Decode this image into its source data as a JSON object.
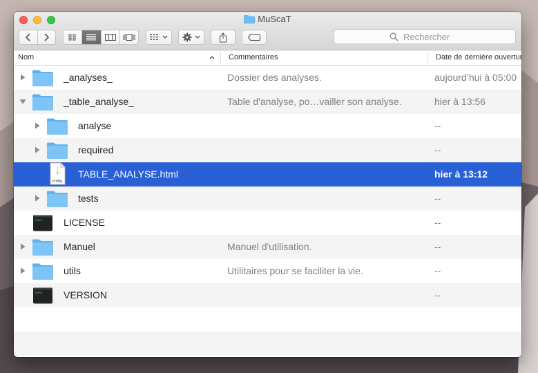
{
  "window": {
    "title": "MuScaT"
  },
  "toolbar": {
    "search_placeholder": "Rechercher",
    "view_mode": "list"
  },
  "columns": {
    "name": "Nom",
    "comments": "Commentaires",
    "date": "Date de dernière ouverture"
  },
  "rows": [
    {
      "name": "_analyses_",
      "comment": "Dossier des analyses.",
      "date": "aujourd’hui à 05:00",
      "kind": "folder",
      "level": 0,
      "disclosure": "collapsed"
    },
    {
      "name": "_table_analyse_",
      "comment": "Table d'analyse, po…vailler son analyse.",
      "date": "hier à 13:56",
      "kind": "folder",
      "level": 0,
      "disclosure": "expanded"
    },
    {
      "name": "analyse",
      "comment": "",
      "date": "--",
      "kind": "folder",
      "level": 1,
      "disclosure": "collapsed"
    },
    {
      "name": "required",
      "comment": "",
      "date": "--",
      "kind": "folder",
      "level": 1,
      "disclosure": "collapsed"
    },
    {
      "name": "TABLE_ANALYSE.html",
      "comment": "",
      "date": "hier à 13:12",
      "kind": "html",
      "level": 1,
      "disclosure": "none",
      "selected": true,
      "icon_label": "HTML"
    },
    {
      "name": "tests",
      "comment": "",
      "date": "--",
      "kind": "folder",
      "level": 1,
      "disclosure": "collapsed"
    },
    {
      "name": "LICENSE",
      "comment": "",
      "date": "--",
      "kind": "exec",
      "level": 0,
      "disclosure": "none",
      "icon_label": "exec"
    },
    {
      "name": "Manuel",
      "comment": "Manuel d'utilisation.",
      "date": "--",
      "kind": "folder",
      "level": 0,
      "disclosure": "collapsed"
    },
    {
      "name": "utils",
      "comment": "Utilitaires pour se faciliter la vie.",
      "date": "--",
      "kind": "folder",
      "level": 0,
      "disclosure": "collapsed"
    },
    {
      "name": "VERSION",
      "comment": "",
      "date": "--",
      "kind": "exec",
      "level": 0,
      "disclosure": "none",
      "icon_label": "exec"
    }
  ],
  "colors": {
    "selection": "#2a60d6",
    "folder": "#7ec4f5",
    "accent": "#1a73e8"
  }
}
